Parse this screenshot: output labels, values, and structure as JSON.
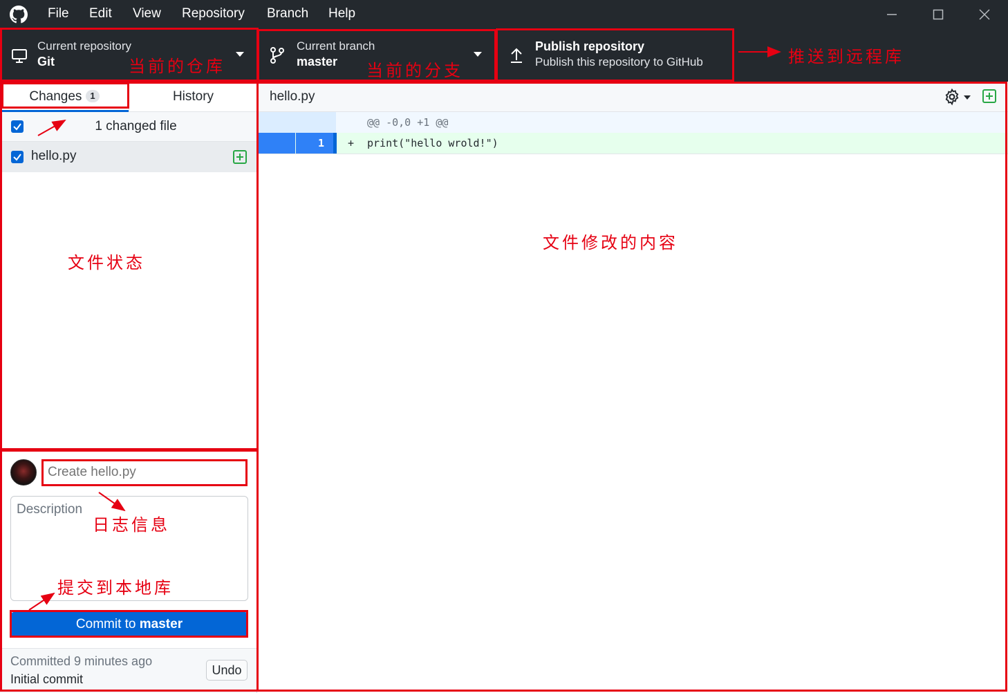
{
  "menu": [
    "File",
    "Edit",
    "View",
    "Repository",
    "Branch",
    "Help"
  ],
  "toolbar": {
    "repo_label": "Current repository",
    "repo_value": "Git",
    "branch_label": "Current branch",
    "branch_value": "master",
    "publish_title": "Publish repository",
    "publish_desc": "Publish this repository to GitHub"
  },
  "tabs": {
    "changes": "Changes",
    "changes_count": "1",
    "history": "History"
  },
  "changes": {
    "summary": "1 changed file",
    "files": [
      {
        "name": "hello.py",
        "status": "added",
        "checked": true
      }
    ]
  },
  "diff": {
    "filename": "hello.py",
    "hunk_header": "@@ -0,0 +1 @@",
    "lines": [
      {
        "new_line": "1",
        "sign": "+",
        "code": "print(\"hello wrold!\")"
      }
    ]
  },
  "commit": {
    "summary_placeholder": "Create hello.py",
    "description_placeholder": "Description",
    "button_prefix": "Commit to ",
    "button_branch": "master"
  },
  "last_commit": {
    "when": "Committed 9 minutes ago",
    "message": "Initial commit",
    "undo": "Undo"
  },
  "annotations": {
    "repo": "当前的仓库",
    "branch": "当前的分支",
    "push": "推送到远程库",
    "file_status": "文件状态",
    "file_content": "文件修改的内容",
    "log_info": "日志信息",
    "commit_local": "提交到本地库"
  },
  "colors": {
    "accent": "#0366d6",
    "annotation": "#e60012",
    "added_bg": "#e6ffed",
    "titlebar": "#24292e"
  }
}
